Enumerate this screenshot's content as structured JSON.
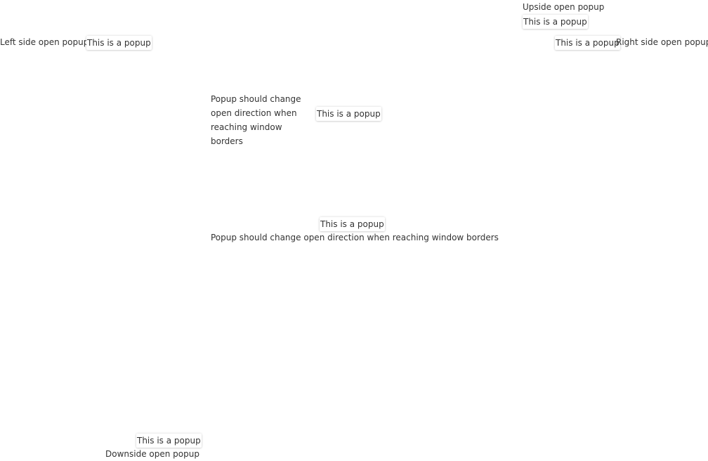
{
  "triggers": {
    "upside": "Upside open popup",
    "left_side": "Left side open popup",
    "right_side": "Right side open popup",
    "auto_vertical_block": "Popup should change open direction when reaching window borders",
    "auto_horizontal_line": "Popup should change open direction when reaching window borders",
    "downside": "Downside open popup"
  },
  "popups": {
    "upside": "This is a popup",
    "left_side": "This is a popup",
    "right_side": "This is a popup",
    "auto_vertical_block": "This is a popup",
    "auto_horizontal_line": "This is a popup",
    "downside": "This is a popup"
  }
}
